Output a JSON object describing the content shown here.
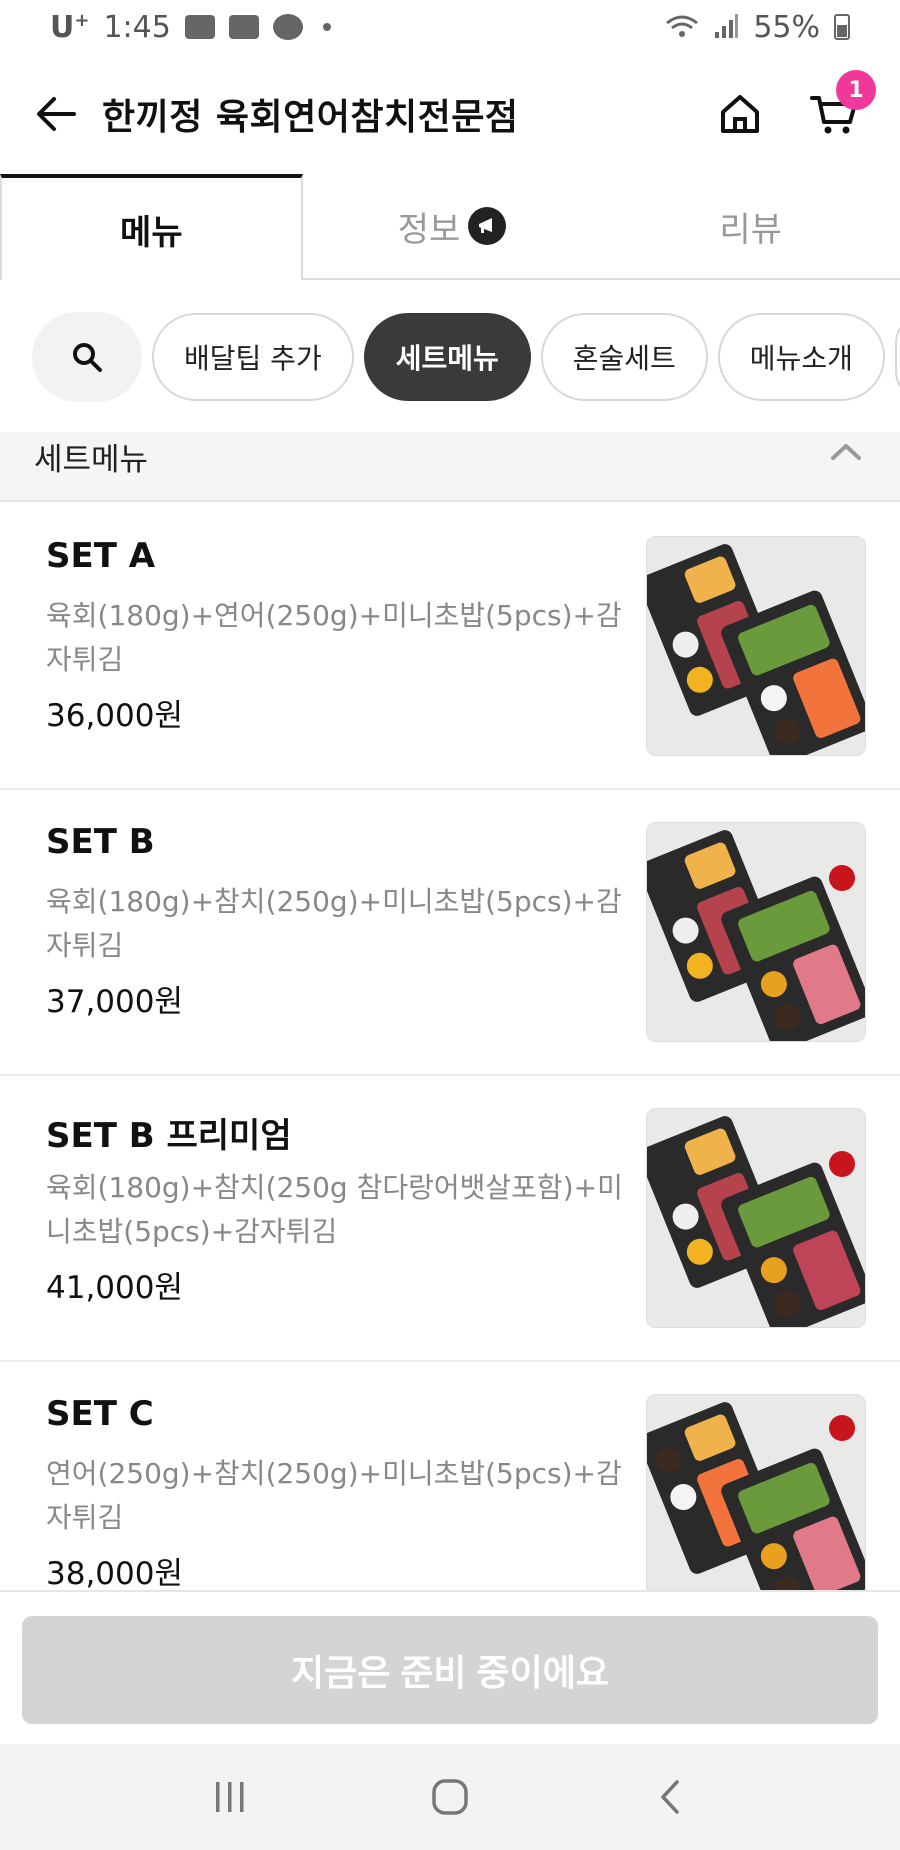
{
  "status_bar": {
    "carrier": "U",
    "carrier_sup": "+",
    "time": "1:45",
    "battery": "55%",
    "icons": [
      "gallery-icon",
      "youtube-icon",
      "kakaotalk-icon",
      "wifi-icon",
      "signal-icon",
      "battery-icon"
    ]
  },
  "header": {
    "title": "한끼정 육회연어참치전문점",
    "cart_count": "1"
  },
  "tabs": [
    {
      "label": "메뉴",
      "active": true
    },
    {
      "label": "정보",
      "active": false
    },
    {
      "label": "리뷰",
      "active": false
    }
  ],
  "chips": [
    {
      "label": "배달팁 추가",
      "active": false
    },
    {
      "label": "세트메뉴",
      "active": true
    },
    {
      "label": "혼술세트",
      "active": false
    },
    {
      "label": "메뉴소개",
      "active": false
    }
  ],
  "section": {
    "title": "세트메뉴"
  },
  "menu_items": [
    {
      "name": "SET A",
      "desc": "육회(180g)+연어(250g)+미니초밥(5pcs)+감자튀김",
      "price": "36,000원"
    },
    {
      "name": "SET B",
      "desc": "육회(180g)+참치(250g)+미니초밥(5pcs)+감자튀김",
      "price": "37,000원"
    },
    {
      "name": "SET B 프리미엄",
      "desc": "육회(180g)+참치(250g 참다랑어뱃살포함)+미니초밥(5pcs)+감자튀김",
      "price": "41,000원"
    },
    {
      "name": "SET C",
      "desc": "연어(250g)+참치(250g)+미니초밥(5pcs)+감자튀김",
      "price": "38,000원"
    }
  ],
  "bottom": {
    "button_label": "지금은 준비 중이에요"
  },
  "colors": {
    "accent_badge": "#f0389a",
    "active_chip": "#3a3a3a",
    "disabled_button": "#d4d4d4"
  }
}
